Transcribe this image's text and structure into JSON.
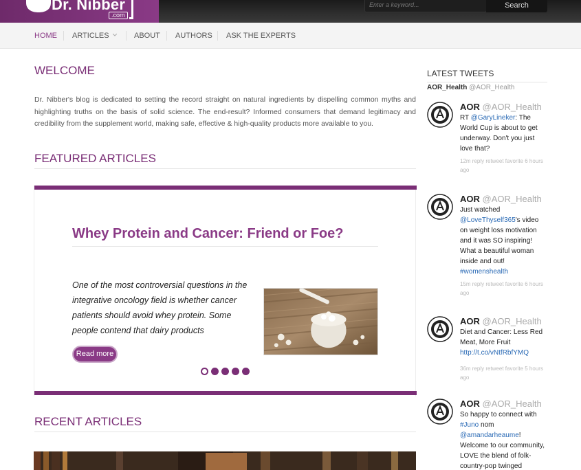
{
  "header": {
    "logo_text": "Dr. Nibber",
    "logo_suffix": ".com",
    "search_placeholder": "Enter a keyword...",
    "search_button": "Search"
  },
  "nav": {
    "home": "HOME",
    "articles": "ARTICLES",
    "about": "ABOUT",
    "authors": "AUTHORS",
    "ask": "ASK THE EXPERTS"
  },
  "welcome": {
    "heading": "WELCOME",
    "text": "Dr. Nibber's blog is dedicated to setting the record straight on natural ingredients by dispelling common myths and highlighting truths on the basis of solid science. The end-result? Informed consumers that demand legitimacy and credibility from the supplement world, making safe, effective & high-quality products more available to you."
  },
  "featured": {
    "heading": "FEATURED ARTICLES",
    "title": "Whey Protein and Cancer: Friend or Foe?",
    "excerpt": "One of the most controversial questions in the integrative oncology field is whether cancer patients should avoid whey protein. Some people contend that dairy products",
    "read_more": "Read more",
    "active_slide": 1,
    "slide_count": 5
  },
  "recent": {
    "heading": "RECENT ARTICLES"
  },
  "sidebar": {
    "title": "LATEST TWEETS",
    "account_name": "AOR_Health",
    "account_handle": "@AOR_Health",
    "tweets": [
      {
        "name": "AOR",
        "handle": "@AOR_Health",
        "parts": [
          [
            "RT ",
            false
          ],
          [
            "@GaryLineker",
            true
          ],
          [
            ": The World Cup is about to get underway. Don't you just love that?",
            false
          ]
        ],
        "meta": "12m reply retweet favorite 6 hours ago"
      },
      {
        "name": "AOR",
        "handle": "@AOR_Health",
        "parts": [
          [
            "Just watched ",
            false
          ],
          [
            "@LoveThyself365",
            true
          ],
          [
            "'s video on weight loss motivation and it was SO inspiring! What a beautiful woman inside and out! ",
            false
          ],
          [
            "#womenshealth",
            true
          ]
        ],
        "meta": "15m reply retweet favorite 6 hours ago"
      },
      {
        "name": "AOR",
        "handle": "@AOR_Health",
        "parts": [
          [
            "Diet and Cancer: Less Red Meat, More Fruit ",
            false
          ],
          [
            "http://t.co/vNtfRbfYMQ",
            true
          ]
        ],
        "meta": "36m reply retweet favorite 5 hours ago"
      },
      {
        "name": "AOR",
        "handle": "@AOR_Health",
        "parts": [
          [
            "So happy to connect with ",
            false
          ],
          [
            "#Juno",
            true
          ],
          [
            " nom ",
            false
          ],
          [
            "@amandarheaume",
            true
          ],
          [
            "! Welcome to our community, LOVE the blend of folk-country-pop twinged",
            false
          ]
        ],
        "meta": ""
      }
    ]
  },
  "colors": {
    "brand": "#7a2e76",
    "link": "#2a6ab5"
  }
}
